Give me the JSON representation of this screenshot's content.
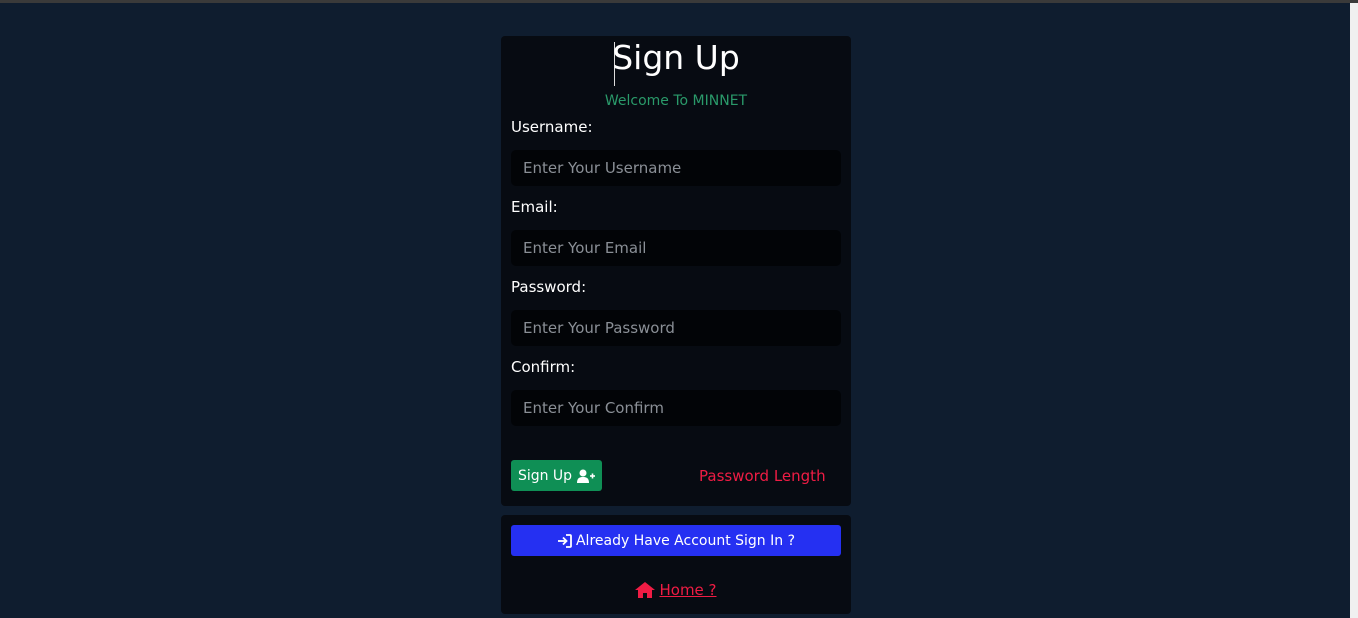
{
  "form": {
    "title": "Sign Up",
    "welcome": "Welcome To MINNET",
    "username_label": "Username:",
    "username_placeholder": "Enter Your Username",
    "email_label": "Email:",
    "email_placeholder": "Enter Your Email",
    "password_label": "Password:",
    "password_placeholder": "Enter Your Password",
    "confirm_label": "Confirm:",
    "confirm_placeholder": "Enter Your Confirm",
    "signup_button": "Sign Up",
    "password_hint": "Password Length"
  },
  "footer": {
    "signin_button": "Already Have Account Sign In ?",
    "home_link": "Home ?"
  },
  "icons": {
    "signup_icon": "user-plus-icon",
    "signin_icon": "sign-in-icon",
    "home_icon": "home-icon"
  },
  "colors": {
    "background": "#0f1d2f",
    "card": "#070b12",
    "accent_green": "#0f8f55",
    "accent_blue": "#2530f2",
    "error_red": "#ef1c44"
  }
}
